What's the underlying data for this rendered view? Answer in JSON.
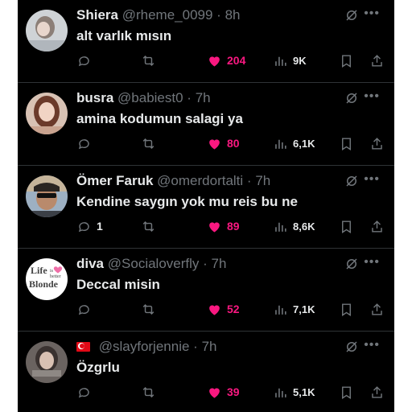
{
  "tweets": [
    {
      "name": "Shiera",
      "handle": "@rheme_0099",
      "separator": "·",
      "time": "8h",
      "text": "alt varlık mısın",
      "replies": "",
      "retweets": "",
      "likes": "204",
      "views": "9K",
      "avatar_icon": "profile-photo",
      "liked": true
    },
    {
      "name": "busra",
      "handle": "@babiest0",
      "separator": "·",
      "time": "7h",
      "text": "amina kodumun salagi ya",
      "replies": "",
      "retweets": "",
      "likes": "80",
      "views": "6,1K",
      "avatar_icon": "profile-photo",
      "liked": true
    },
    {
      "name": "Ömer Faruk",
      "handle": "@omerdortalti",
      "separator": "·",
      "time": "7h",
      "text": "Kendine saygın yok mu reis bu ne",
      "replies": "1",
      "retweets": "",
      "likes": "89",
      "views": "8,6K",
      "avatar_icon": "profile-photo",
      "liked": true
    },
    {
      "name": "diva",
      "handle": "@Socialoverfly",
      "separator": "·",
      "time": "7h",
      "text": "Deccal misin",
      "replies": "",
      "retweets": "",
      "likes": "52",
      "views": "7,1K",
      "avatar_icon": "life-is-better-blonde-logo",
      "avatar_text": [
        "Life",
        "is",
        "better",
        "Blonde"
      ],
      "liked": true
    },
    {
      "name": "",
      "flag": "turkey-flag-icon",
      "handle": "@slayforjennie",
      "separator": "·",
      "time": "7h",
      "text": "Özgrlu",
      "replies": "",
      "retweets": "",
      "likes": "39",
      "views": "5,1K",
      "avatar_icon": "profile-photo",
      "liked": true
    }
  ],
  "colors": {
    "background": "#000000",
    "text_primary": "#e7e9ea",
    "text_secondary": "#71767b",
    "like_pink": "#f91880",
    "divider": "#2f3336"
  }
}
